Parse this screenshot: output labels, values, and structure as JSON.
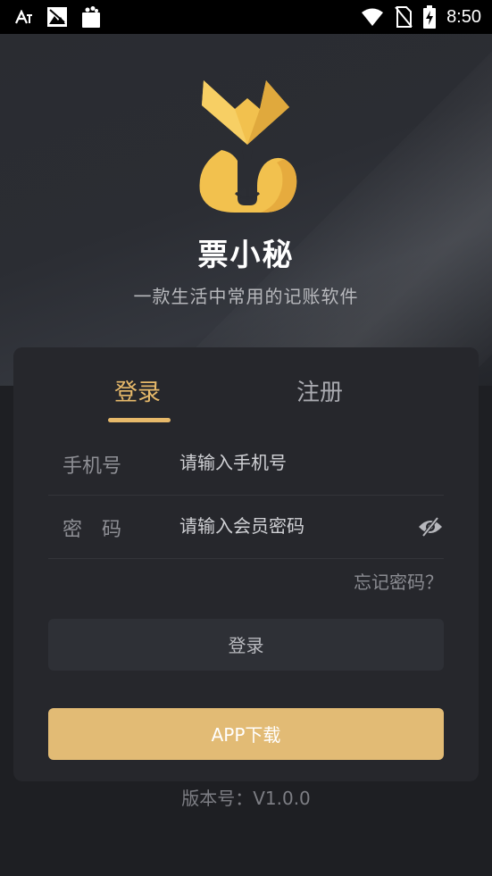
{
  "status_bar": {
    "time": "8:50",
    "left_icons": [
      "font-icon",
      "photo-icon",
      "shopping-bag-icon"
    ],
    "right_icons": [
      "wifi-icon",
      "no-sim-icon",
      "battery-charging-icon"
    ]
  },
  "app": {
    "name": "票小秘",
    "slogan": "一款生活中常用的记账软件",
    "logo_icon": "fox-logo-icon",
    "brand_color": "#e7b96a"
  },
  "tabs": [
    {
      "label": "登录",
      "active": true
    },
    {
      "label": "注册",
      "active": false
    }
  ],
  "form": {
    "phone": {
      "label": "手机号",
      "placeholder": "请输入手机号",
      "value": ""
    },
    "password": {
      "label": "密　码",
      "placeholder": "请输入会员密码",
      "value": "",
      "toggle_icon": "eye-off-icon"
    },
    "forgot_label": "忘记密码？"
  },
  "buttons": {
    "login_label": "登录",
    "download_label": "APP下载",
    "download_color": "#e2bb75"
  },
  "footer": {
    "version": "版本号：V1.0.0"
  }
}
